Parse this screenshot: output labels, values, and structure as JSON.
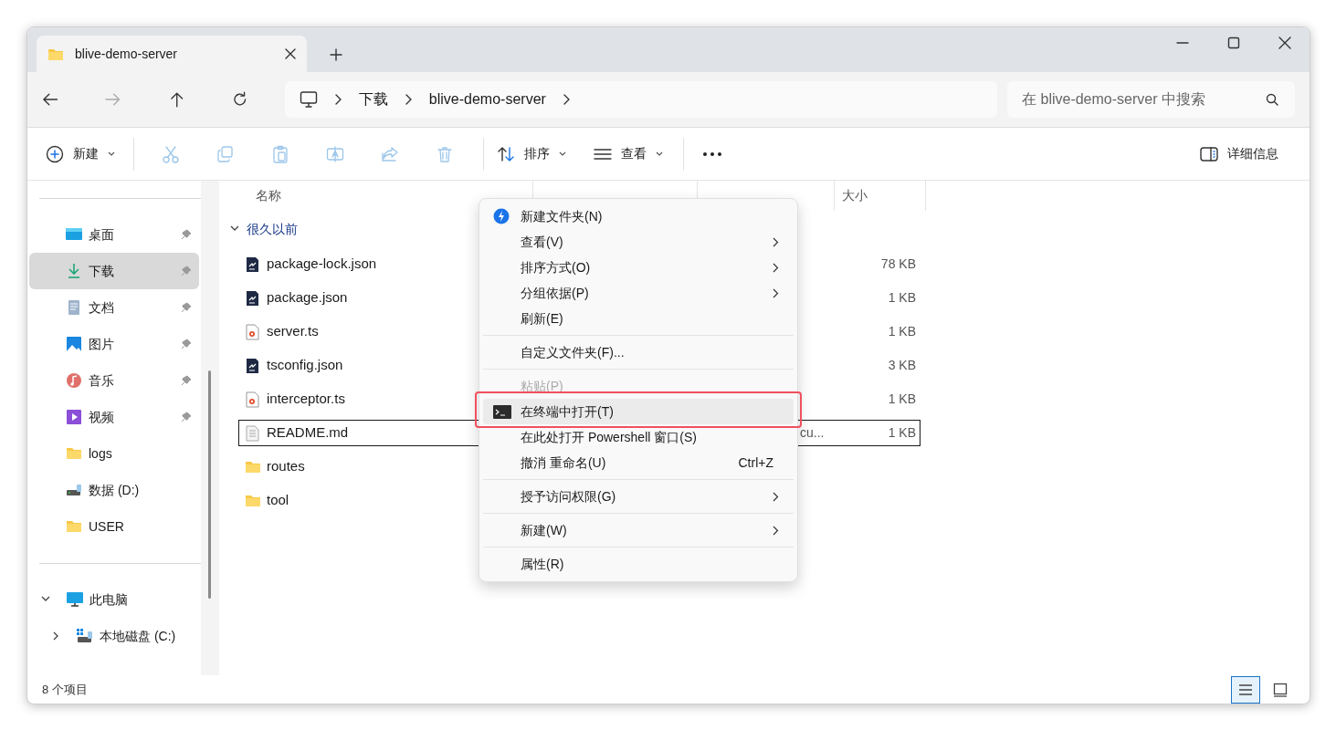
{
  "window": {
    "tab_title": "blive-demo-server"
  },
  "address": {
    "breadcrumbs": [
      "下载",
      "blive-demo-server"
    ],
    "search_placeholder": "在 blive-demo-server 中搜索"
  },
  "toolbar": {
    "new_label": "新建",
    "actions": [
      {
        "kind": "cut",
        "disabled": true
      },
      {
        "kind": "copy",
        "disabled": true
      },
      {
        "kind": "paste",
        "disabled": true
      },
      {
        "kind": "rename",
        "disabled": true
      },
      {
        "kind": "share",
        "disabled": true
      },
      {
        "kind": "delete",
        "disabled": true
      }
    ],
    "sort_label": "排序",
    "view_label": "查看",
    "details_label": "详细信息"
  },
  "sidebar": {
    "quick_access": [
      {
        "label": "桌面",
        "kind": "desktop",
        "pinned": true,
        "selected": false
      },
      {
        "label": "下载",
        "kind": "download",
        "pinned": true,
        "selected": true
      },
      {
        "label": "文档",
        "kind": "document",
        "pinned": true,
        "selected": false
      },
      {
        "label": "图片",
        "kind": "pictures",
        "pinned": true,
        "selected": false
      },
      {
        "label": "音乐",
        "kind": "music",
        "pinned": true,
        "selected": false
      },
      {
        "label": "视频",
        "kind": "video",
        "pinned": true,
        "selected": false
      },
      {
        "label": "logs",
        "kind": "folder",
        "pinned": false,
        "selected": false
      },
      {
        "label": "数据 (D:)",
        "kind": "drive",
        "pinned": false,
        "selected": false
      },
      {
        "label": "USER",
        "kind": "folder",
        "pinned": false,
        "selected": false
      }
    ],
    "this_pc": {
      "label": "此电脑",
      "expanded": true,
      "children": [
        {
          "label": "本地磁盘 (C:)",
          "kind": "system-drive",
          "expanded": false
        }
      ]
    }
  },
  "columns": [
    "名称",
    "大小"
  ],
  "group": {
    "label": "很久以前",
    "expanded": true
  },
  "files": [
    {
      "name": "package-lock.json",
      "kind": "json",
      "size": "78 KB",
      "focused": false
    },
    {
      "name": "package.json",
      "kind": "json",
      "size": "1 KB",
      "focused": false
    },
    {
      "name": "server.ts",
      "kind": "ts",
      "size": "1 KB",
      "focused": false
    },
    {
      "name": "tsconfig.json",
      "kind": "json",
      "size": "3 KB",
      "focused": false
    },
    {
      "name": "interceptor.ts",
      "kind": "ts",
      "size": "1 KB",
      "focused": false
    },
    {
      "name": "README.md",
      "kind": "md",
      "type": "cu...",
      "size": "1 KB",
      "focused": true
    },
    {
      "name": "routes",
      "kind": "folder",
      "focused": false
    },
    {
      "name": "tool",
      "kind": "folder",
      "focused": false
    }
  ],
  "context_menu": [
    {
      "kind": "item",
      "label": "新建文件夹(N)",
      "submenu": false,
      "disabled": false,
      "highlighted": false
    },
    {
      "kind": "item",
      "label": "查看(V)",
      "submenu": true,
      "disabled": false,
      "highlighted": false
    },
    {
      "kind": "item",
      "label": "排序方式(O)",
      "submenu": true,
      "disabled": false,
      "highlighted": false
    },
    {
      "kind": "item",
      "label": "分组依据(P)",
      "submenu": true,
      "disabled": false,
      "highlighted": false
    },
    {
      "kind": "item",
      "label": "刷新(E)",
      "submenu": false,
      "disabled": false,
      "highlighted": false
    },
    {
      "kind": "separator"
    },
    {
      "kind": "item",
      "label": "自定义文件夹(F)...",
      "submenu": false,
      "disabled": false,
      "highlighted": false
    },
    {
      "kind": "separator"
    },
    {
      "kind": "item",
      "label": "粘贴(P)",
      "submenu": false,
      "disabled": true,
      "highlighted": false
    },
    {
      "kind": "item",
      "label": "在终端中打开(T)",
      "submenu": false,
      "disabled": false,
      "highlighted": true
    },
    {
      "kind": "item",
      "label": "在此处打开 Powershell 窗口(S)",
      "submenu": false,
      "disabled": false,
      "highlighted": false
    },
    {
      "kind": "item",
      "label": "撤消 重命名(U)",
      "shortcut": "Ctrl+Z",
      "submenu": false,
      "disabled": false,
      "highlighted": false
    },
    {
      "kind": "separator"
    },
    {
      "kind": "item",
      "label": "授予访问权限(G)",
      "submenu": true,
      "disabled": false,
      "highlighted": false
    },
    {
      "kind": "separator"
    },
    {
      "kind": "item",
      "label": "新建(W)",
      "submenu": true,
      "disabled": false,
      "highlighted": false
    },
    {
      "kind": "separator"
    },
    {
      "kind": "item",
      "label": "属性(R)",
      "submenu": false,
      "disabled": false,
      "highlighted": false
    }
  ],
  "status_bar": {
    "item_count": "8 个项目",
    "views": [
      {
        "kind": "details",
        "selected": true
      },
      {
        "kind": "tiles",
        "selected": false
      }
    ]
  }
}
